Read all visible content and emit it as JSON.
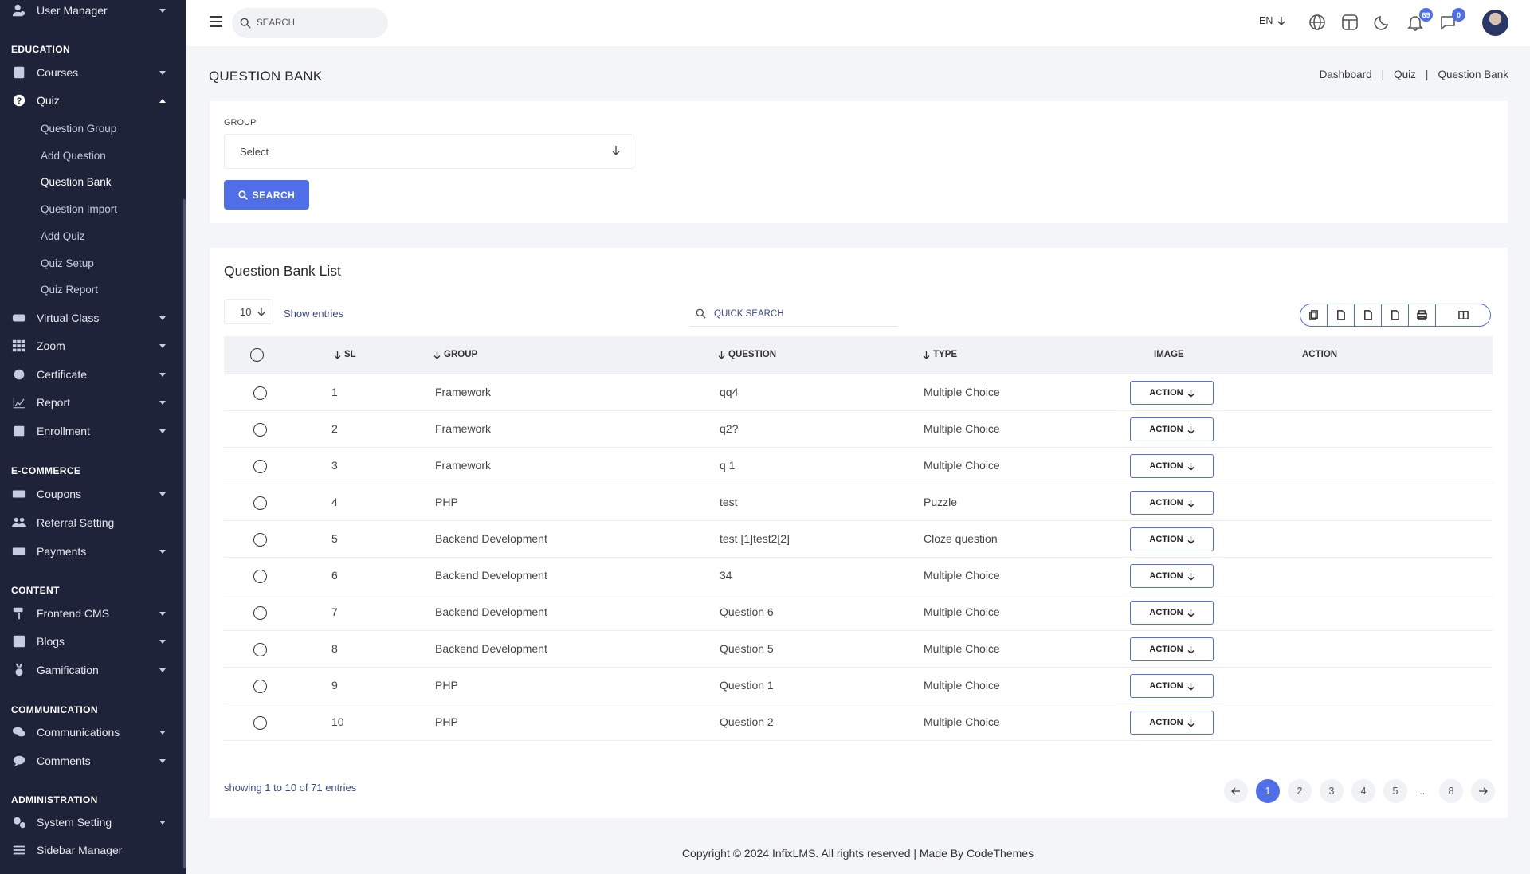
{
  "sidebar": {
    "top_item": "User Manager",
    "sections": {
      "education": "EDUCATION",
      "ecommerce": "E-COMMERCE",
      "content": "CONTENT",
      "communication": "COMMUNICATION",
      "administration": "ADMINISTRATION"
    },
    "items": {
      "courses": "Courses",
      "quiz": "Quiz",
      "virtual_class": "Virtual Class",
      "zoom": "Zoom",
      "certificate": "Certificate",
      "report": "Report",
      "enrollment": "Enrollment",
      "coupons": "Coupons",
      "referral": "Referral Setting",
      "payments": "Payments",
      "frontend_cms": "Frontend CMS",
      "blogs": "Blogs",
      "gamification": "Gamification",
      "communications": "Communications",
      "comments": "Comments",
      "system_setting": "System Setting",
      "sidebar_manager": "Sidebar Manager"
    },
    "quiz_sub": [
      "Question Group",
      "Add Question",
      "Question Bank",
      "Question Import",
      "Add Quiz",
      "Quiz Setup",
      "Quiz Report"
    ]
  },
  "topbar": {
    "search_placeholder": "SEARCH",
    "lang": "EN",
    "notif_count": "69",
    "msg_count": "0"
  },
  "header": {
    "title": "QUESTION BANK",
    "breadcrumb": [
      "Dashboard",
      "Quiz",
      "Question Bank"
    ]
  },
  "filter": {
    "group_label": "GROUP",
    "group_value": "Select",
    "search_label": "SEARCH"
  },
  "list": {
    "title": "Question Bank List",
    "page_length": "10",
    "show_entries": "Show entries",
    "quick_search_placeholder": "QUICK SEARCH",
    "columns": [
      "SL",
      "GROUP",
      "QUESTION",
      "TYPE",
      "IMAGE",
      "ACTION"
    ],
    "rows": [
      {
        "sl": "1",
        "group": "Framework",
        "question": "qq4",
        "type": "Multiple Choice"
      },
      {
        "sl": "2",
        "group": "Framework",
        "question": "q2?",
        "type": "Multiple Choice"
      },
      {
        "sl": "3",
        "group": "Framework",
        "question": "q 1",
        "type": "Multiple Choice"
      },
      {
        "sl": "4",
        "group": "PHP",
        "question": "test",
        "type": "Puzzle"
      },
      {
        "sl": "5",
        "group": "Backend Development",
        "question": "test [1]test2[2]",
        "type": "Cloze question"
      },
      {
        "sl": "6",
        "group": "Backend Development",
        "question": "34",
        "type": "Multiple Choice"
      },
      {
        "sl": "7",
        "group": "Backend Development",
        "question": "Question 6",
        "type": "Multiple Choice"
      },
      {
        "sl": "8",
        "group": "Backend Development",
        "question": "Question 5",
        "type": "Multiple Choice"
      },
      {
        "sl": "9",
        "group": "PHP",
        "question": "Question 1",
        "type": "Multiple Choice"
      },
      {
        "sl": "10",
        "group": "PHP",
        "question": "Question 2",
        "type": "Multiple Choice"
      }
    ],
    "action_label": "ACTION",
    "showing": "showing 1 to 10 of 71 entries",
    "pages": [
      "1",
      "2",
      "3",
      "4",
      "5",
      "...",
      "8"
    ]
  },
  "footer": "Copyright © 2024 InfixLMS. All rights reserved | Made By CodeThemes",
  "colors": {
    "accent": "#4f6ee8",
    "sidebar": "#1f2339"
  }
}
